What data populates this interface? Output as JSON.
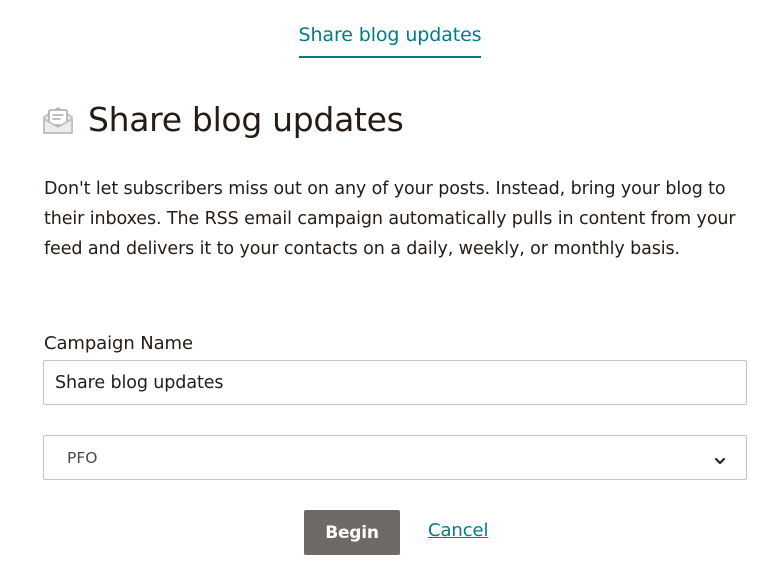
{
  "tab": {
    "label": "Share blog updates"
  },
  "header": {
    "title": "Share blog updates",
    "icon": "envelope-document-icon"
  },
  "description": "Don't let subscribers miss out on any of your posts. Instead, bring your blog to their inboxes. The RSS email campaign automatically pulls in content from your feed and delivers it to your contacts on a daily, weekly, or monthly basis.",
  "form": {
    "campaign_name_label": "Campaign Name",
    "campaign_name_value": "Share blog updates",
    "audience_selected": "PFO"
  },
  "actions": {
    "begin_label": "Begin",
    "cancel_label": "Cancel"
  },
  "colors": {
    "accent": "#007c89",
    "button_bg": "#6f6a66",
    "text": "#241c15"
  }
}
